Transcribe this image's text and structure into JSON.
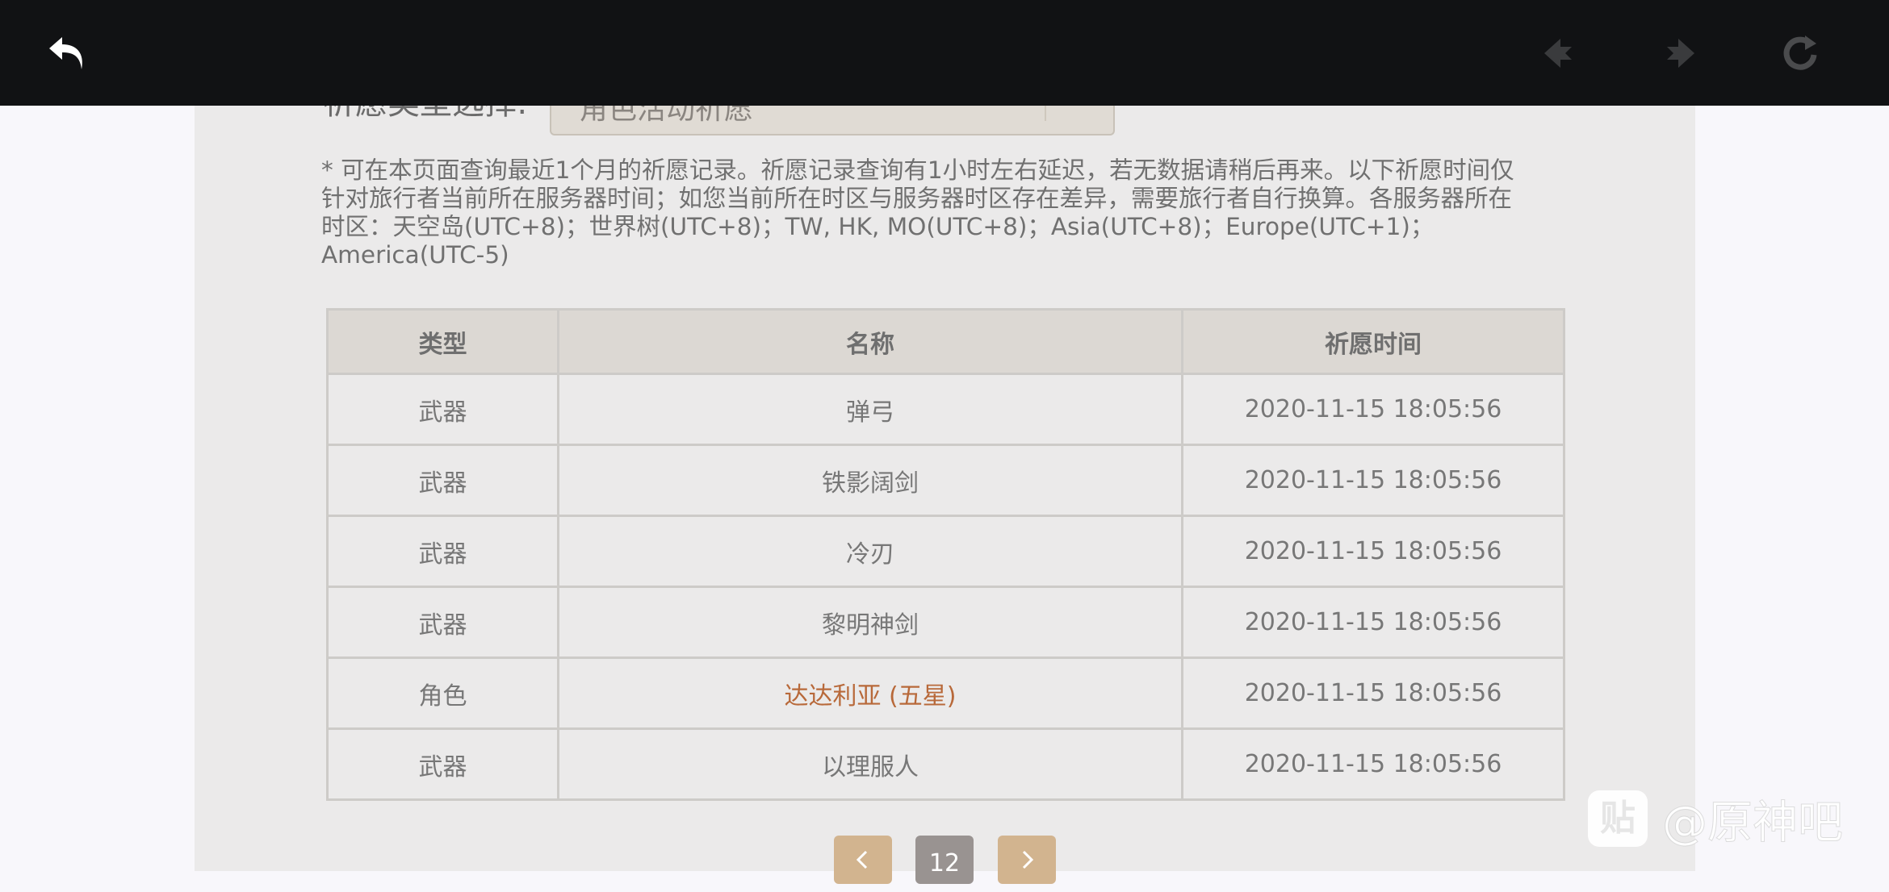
{
  "filter": {
    "label": "祈愿类型选择:",
    "selected_value": "角色活动祈愿"
  },
  "notice_lines": [
    "* 可在本页面查询最近1个月的祈愿记录。祈愿记录查询有1小时左右延迟，若无数据请稍后再来。以下祈愿时间仅",
    "针对旅行者当前所在服务器时间；如您当前所在时区与服务器时区存在差异，需要旅行者自行换算。各服务器所在",
    "时区：天空岛(UTC+8)；世界树(UTC+8)；TW, HK, MO(UTC+8)；Asia(UTC+8)；Europe(UTC+1)；",
    "America(UTC-5)"
  ],
  "table": {
    "headers": [
      "类型",
      "名称",
      "祈愿时间"
    ],
    "rows": [
      {
        "type": "武器",
        "name": "弹弓",
        "time": "2020-11-15 18:05:56"
      },
      {
        "type": "武器",
        "name": "铁影阔剑",
        "time": "2020-11-15 18:05:56"
      },
      {
        "type": "武器",
        "name": "冷刃",
        "time": "2020-11-15 18:05:56"
      },
      {
        "type": "武器",
        "name": "黎明神剑",
        "time": "2020-11-15 18:05:56"
      },
      {
        "type": "角色",
        "name": "达达利亚 (五星)",
        "time": "2020-11-15 18:05:56"
      },
      {
        "type": "武器",
        "name": "以理服人",
        "time": "2020-11-15 18:05:56"
      }
    ]
  },
  "pagination": {
    "current_page": "12"
  },
  "watermark": {
    "badge": "贴",
    "text": "@原神吧"
  },
  "colors": {
    "topbar": "#111214",
    "panel": "#ebeaea",
    "header_bg": "#dcd8d3",
    "five_star_text": "#b8693a",
    "pager_button": "#d2b48f",
    "pager_current": "#999391"
  },
  "icons": {
    "back": "back-arrow-icon",
    "prev": "nav-back-icon",
    "next": "nav-forward-icon",
    "refresh": "refresh-icon",
    "pager_prev": "chevron-left-icon",
    "pager_next": "chevron-right-icon"
  }
}
